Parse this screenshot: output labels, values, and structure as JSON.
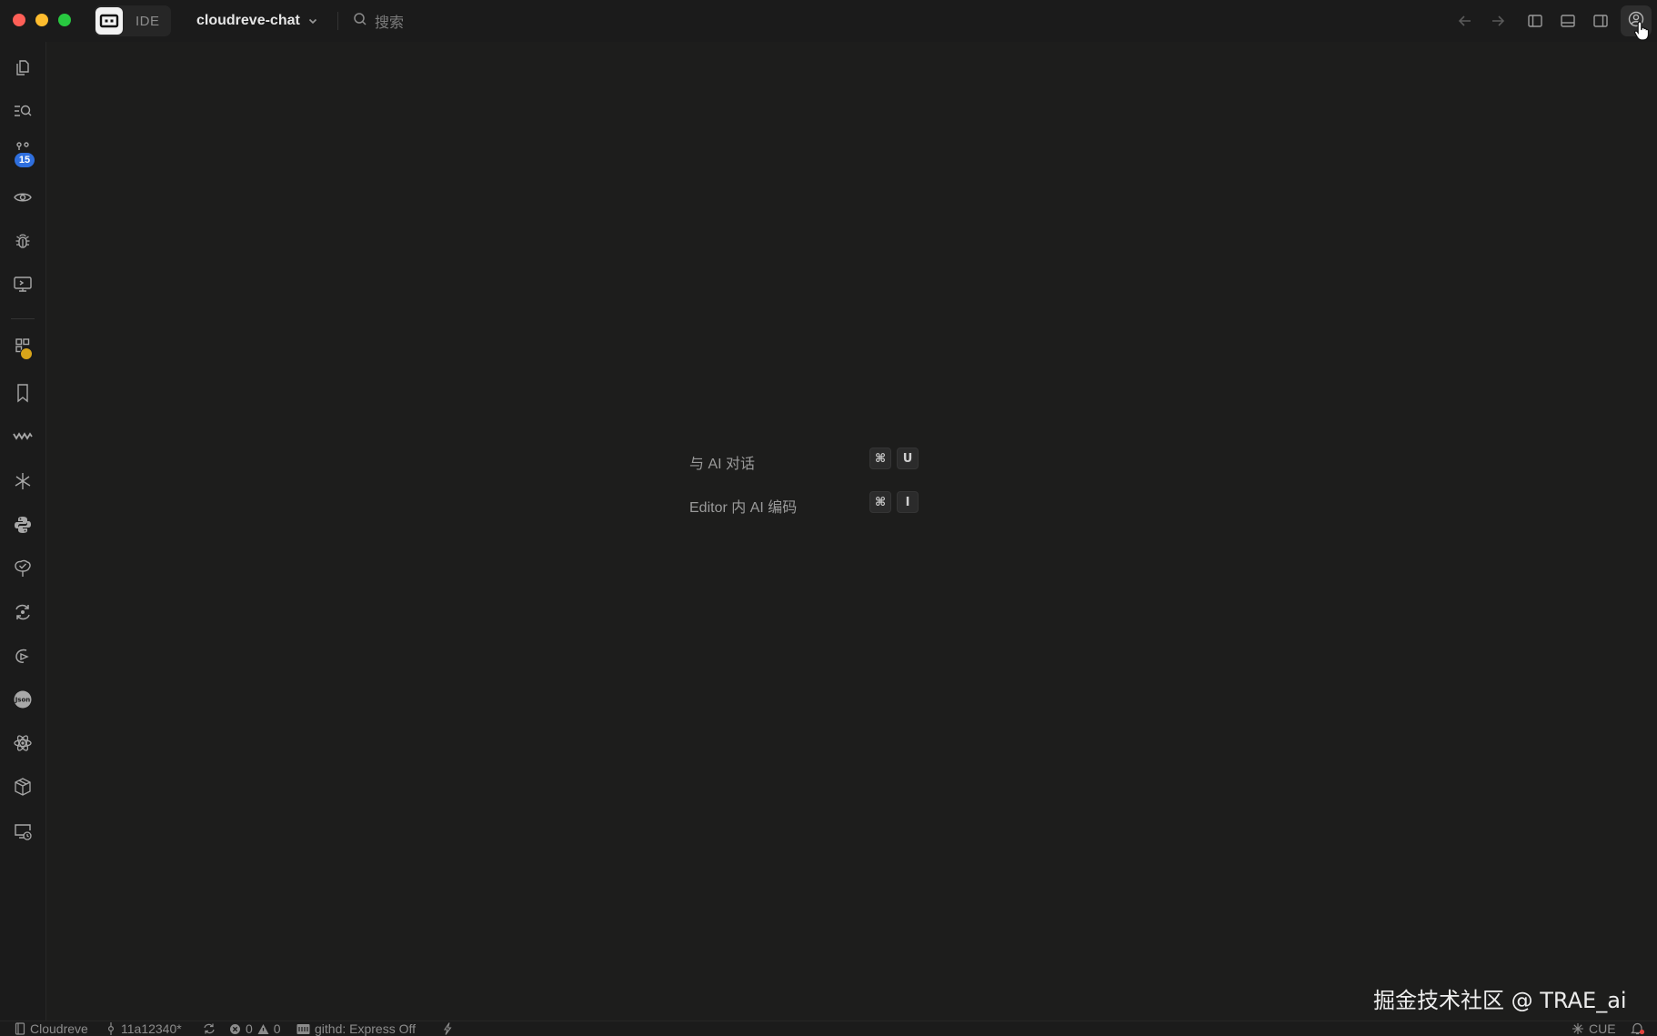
{
  "titlebar": {
    "mode_label": "IDE",
    "project_name": "cloudreve-chat",
    "search_placeholder": "搜索"
  },
  "activity_bar": {
    "items": [
      {
        "icon": "files-icon"
      },
      {
        "icon": "search-list-icon"
      },
      {
        "icon": "source-control-icon",
        "badge": "15"
      },
      {
        "icon": "eye-icon"
      },
      {
        "icon": "bug-icon"
      },
      {
        "icon": "remote-explorer-icon"
      },
      {
        "icon": "extensions-icon",
        "badge_color": "#d9a51a"
      },
      {
        "icon": "bookmark-icon"
      },
      {
        "icon": "wave-icon"
      },
      {
        "icon": "asterisk-icon"
      },
      {
        "icon": "python-icon"
      },
      {
        "icon": "tree-check-icon"
      },
      {
        "icon": "sync-icon"
      },
      {
        "icon": "run-icon"
      },
      {
        "icon": "json-icon"
      },
      {
        "icon": "react-icon"
      },
      {
        "icon": "package-icon"
      },
      {
        "icon": "remote-monitor-icon"
      }
    ]
  },
  "editor": {
    "hints": [
      {
        "label": "与 AI 对话",
        "keys": [
          "⌘",
          "U"
        ]
      },
      {
        "label": "Editor 内 AI 编码",
        "keys": [
          "⌘",
          "I"
        ]
      }
    ],
    "watermark": "掘金技术社区 @ TRAE_ai"
  },
  "statusbar": {
    "repo": "Cloudreve",
    "branch": "11a12340*",
    "errors": "0",
    "warnings": "0",
    "githd": "githd: Express Off",
    "language": "CUE"
  },
  "colors": {
    "background": "#1d1d1c",
    "badge_blue": "#2f6fde",
    "badge_yellow": "#d9a51a",
    "close": "#fe5f57",
    "minimize": "#febc2e",
    "maximize": "#28c840"
  }
}
